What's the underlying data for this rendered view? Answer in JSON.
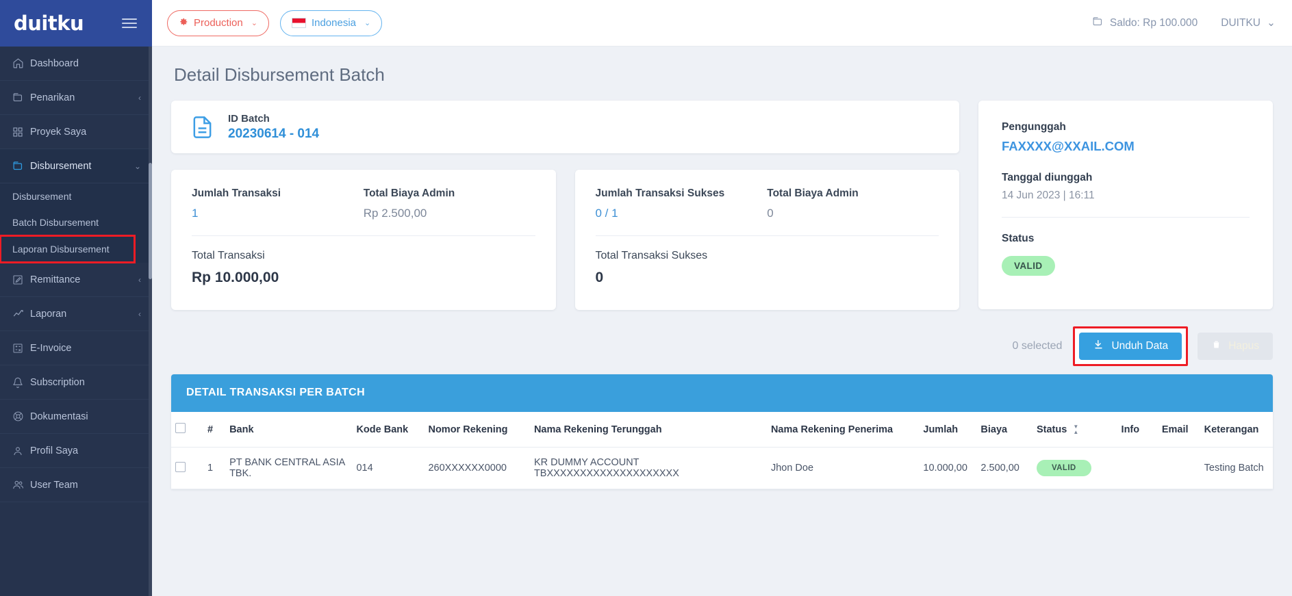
{
  "brand": {
    "logo_text": "duitku"
  },
  "sidebar": {
    "items": [
      {
        "label": "Dashboard",
        "icon": "home-icon",
        "caret": "",
        "active": false
      },
      {
        "label": "Penarikan",
        "icon": "wallet-icon",
        "caret": "‹",
        "active": false
      },
      {
        "label": "Proyek Saya",
        "icon": "grid-icon",
        "caret": "",
        "active": false
      },
      {
        "label": "Disbursement",
        "icon": "wallet-icon",
        "caret": "⌄",
        "active": true
      }
    ],
    "sub_items": [
      {
        "label": "Disbursement",
        "highlight": false
      },
      {
        "label": "Batch Disbursement",
        "highlight": false
      },
      {
        "label": "Laporan Disbursement",
        "highlight": true
      }
    ],
    "items_after": [
      {
        "label": "Remittance",
        "icon": "edit-square-icon",
        "caret": "‹"
      },
      {
        "label": "Laporan",
        "icon": "line-chart-icon",
        "caret": "‹"
      },
      {
        "label": "E-Invoice",
        "icon": "calculator-icon",
        "caret": ""
      },
      {
        "label": "Subscription",
        "icon": "bell-icon",
        "caret": ""
      },
      {
        "label": "Dokumentasi",
        "icon": "lifebuoy-icon",
        "caret": ""
      },
      {
        "label": "Profil Saya",
        "icon": "user-icon",
        "caret": ""
      },
      {
        "label": "User Team",
        "icon": "users-icon",
        "caret": ""
      }
    ]
  },
  "topbar": {
    "environment_label": "Production",
    "country_label": "Indonesia",
    "balance_label": "Saldo: Rp 100.000",
    "account_label": "DUITKU",
    "chevron": "⌄"
  },
  "page": {
    "title": "Detail Disbursement Batch"
  },
  "id_batch_card": {
    "label": "ID Batch",
    "value": "20230614 - 014"
  },
  "stat_card_1": {
    "label_a": "Jumlah Transaksi",
    "value_a": "1",
    "label_b": "Total Biaya Admin",
    "value_b": "Rp 2.500,00",
    "label_total": "Total Transaksi",
    "value_total": "Rp 10.000,00"
  },
  "stat_card_2": {
    "label_a": "Jumlah Transaksi Sukses",
    "value_a": "0 / 1",
    "label_b": "Total Biaya Admin",
    "value_b": "0",
    "label_total": "Total Transaksi Sukses",
    "value_total": "0"
  },
  "uploader_card": {
    "uploader_label": "Pengunggah",
    "uploader_email": "FAXXXX@XXAIL.COM",
    "date_label": "Tanggal diunggah",
    "date_value": "14 Jun 2023 | 16:11",
    "status_label": "Status",
    "status_badge": "VALID"
  },
  "actions": {
    "selected_text": "0 selected",
    "download_label": "Unduh Data",
    "delete_label": "Hapus"
  },
  "table": {
    "title": "DETAIL TRANSAKSI PER BATCH",
    "columns": [
      "",
      "#",
      "Bank",
      "Kode Bank",
      "Nomor Rekening",
      "Nama Rekening Terunggah",
      "Nama Rekening Penerima",
      "Jumlah",
      "Biaya",
      "Status",
      "Info",
      "Email",
      "Keterangan"
    ],
    "rows": [
      {
        "num": "1",
        "bank": "PT BANK CENTRAL ASIA TBK.",
        "kode_bank": "014",
        "nomor_rekening": "260XXXXXX0000",
        "nama_rekening_terunggah": "KR DUMMY ACCOUNT TBXXXXXXXXXXXXXXXXXXXX",
        "nama_rekening_penerima": "Jhon Doe",
        "jumlah": "10.000,00",
        "biaya": "2.500,00",
        "status": "VALID",
        "info": "",
        "email": "",
        "keterangan": "Testing Batch"
      }
    ]
  },
  "colors": {
    "brand_blue": "#2f4b9b",
    "sidebar_bg": "#26334d",
    "accent_blue": "#36a0e0",
    "valid_green": "#a8f0b6",
    "highlight_red": "#ee1c25",
    "production_red": "#ec5f58"
  }
}
